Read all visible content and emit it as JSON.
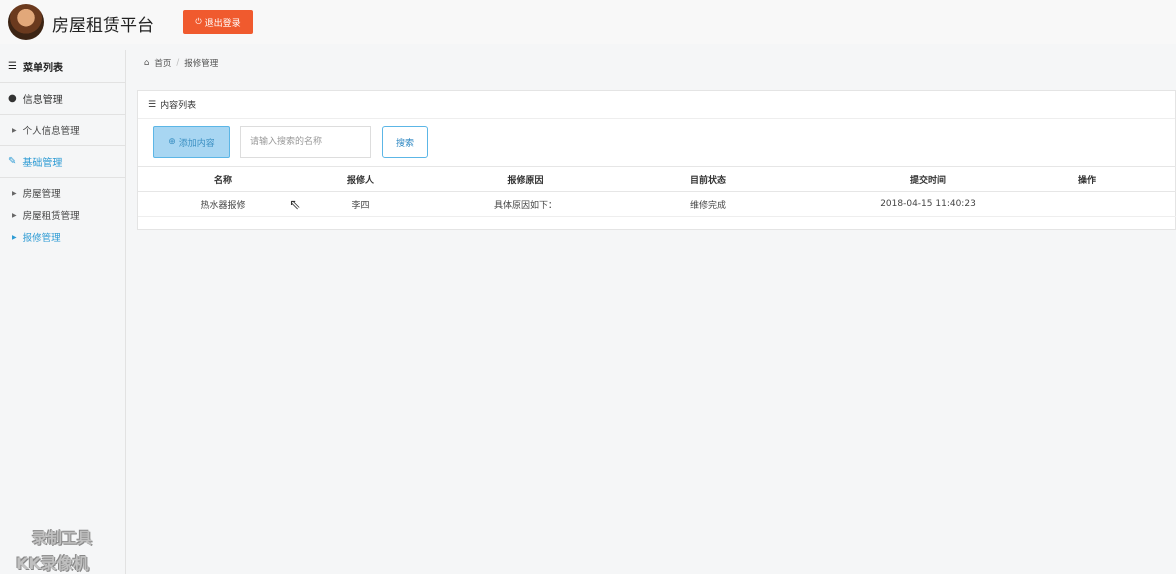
{
  "header": {
    "brand": "房屋租赁平台",
    "logout_label": "退出登录",
    "logout_icon": "power-icon"
  },
  "sidebar": {
    "title": "菜单列表",
    "groups": [
      {
        "label": "信息管理",
        "icon": "user-icon",
        "items": [
          {
            "label": "个人信息管理"
          }
        ]
      },
      {
        "label": "基础管理",
        "icon": "edit-icon",
        "active": true,
        "items": [
          {
            "label": "房屋管理"
          },
          {
            "label": "房屋租赁管理"
          },
          {
            "label": "报修管理",
            "active": true
          }
        ]
      }
    ]
  },
  "breadcrumb": {
    "home": "首页",
    "current": "报修管理"
  },
  "panel": {
    "title": "内容列表",
    "add_label": "添加内容",
    "search_placeholder": "请输入搜索的名称",
    "search_label": "搜索"
  },
  "table": {
    "columns": [
      "名称",
      "报修人",
      "报修原因",
      "目前状态",
      "提交时间",
      "操作"
    ],
    "rows": [
      [
        "热水器报修",
        "李四",
        "具体原因如下：",
        "维修完成",
        "2018-04-15 11:40:23",
        ""
      ]
    ]
  },
  "watermark": {
    "line1": "录制工具",
    "line2": "KK录像机"
  },
  "colors": {
    "accent": "#2d9bd4",
    "logout": "#f05a2e",
    "add_button_bg": "#a8d6f2"
  }
}
